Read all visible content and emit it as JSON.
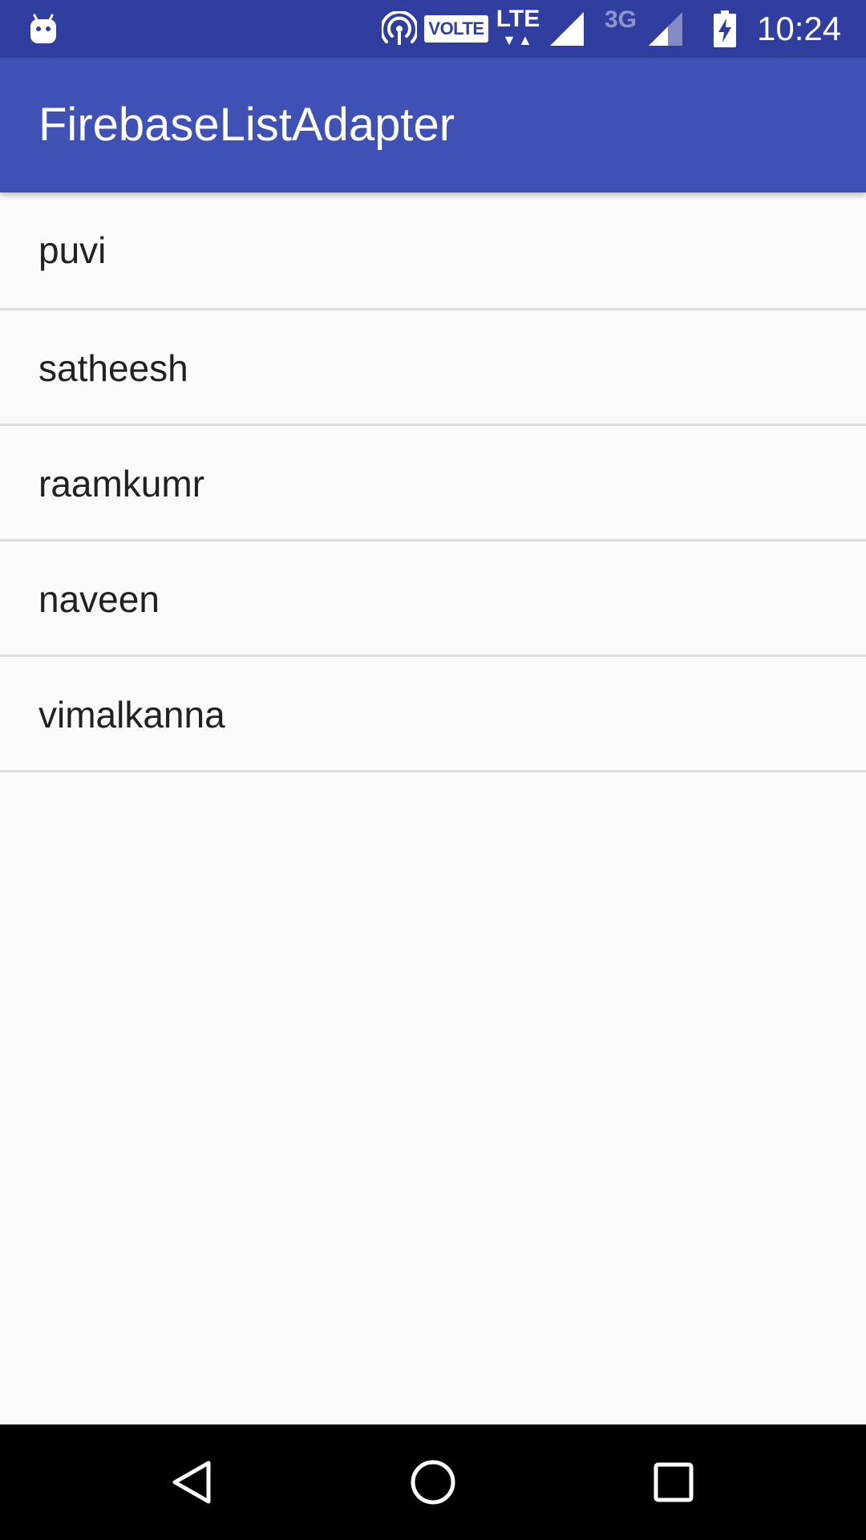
{
  "status_bar": {
    "background": "#303F9F",
    "notification_icon": "android-debug-icon",
    "volte_label": "VOLTE",
    "lte_label": "LTE",
    "lte_arrows": "▼▲",
    "network_3g_label": "3G",
    "clock": "10:24"
  },
  "app_bar": {
    "title": "FirebaseListAdapter",
    "background": "#3F51B5"
  },
  "list": {
    "items": [
      {
        "label": "puvi"
      },
      {
        "label": "satheesh"
      },
      {
        "label": "raamkumr"
      },
      {
        "label": "naveen"
      },
      {
        "label": "vimalkanna"
      }
    ]
  },
  "nav_bar": {
    "background": "#000000",
    "buttons": [
      "back-icon",
      "home-icon",
      "recents-icon"
    ]
  }
}
